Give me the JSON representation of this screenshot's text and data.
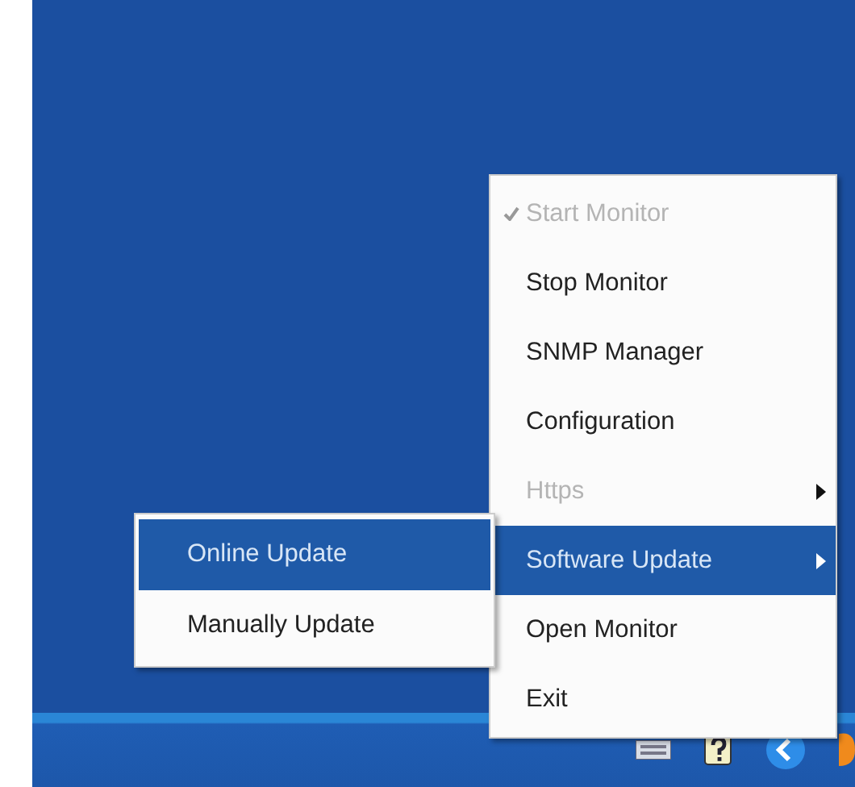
{
  "menu": {
    "items": [
      {
        "label": "Start Monitor",
        "checked": true,
        "disabled": true,
        "submenu": false,
        "selected": false
      },
      {
        "label": "Stop Monitor",
        "checked": false,
        "disabled": false,
        "submenu": false,
        "selected": false
      },
      {
        "label": "SNMP Manager",
        "checked": false,
        "disabled": false,
        "submenu": false,
        "selected": false
      },
      {
        "label": "Configuration",
        "checked": false,
        "disabled": false,
        "submenu": false,
        "selected": false
      },
      {
        "label": "Https",
        "checked": false,
        "disabled": true,
        "submenu": true,
        "selected": false
      },
      {
        "label": "Software Update",
        "checked": false,
        "disabled": false,
        "submenu": true,
        "selected": true
      },
      {
        "label": "Open Monitor",
        "checked": false,
        "disabled": false,
        "submenu": false,
        "selected": false
      },
      {
        "label": "Exit",
        "checked": false,
        "disabled": false,
        "submenu": false,
        "selected": false
      }
    ]
  },
  "submenu": {
    "items": [
      {
        "label": "Online Update",
        "selected": true
      },
      {
        "label": "Manually Update",
        "selected": false
      }
    ]
  }
}
